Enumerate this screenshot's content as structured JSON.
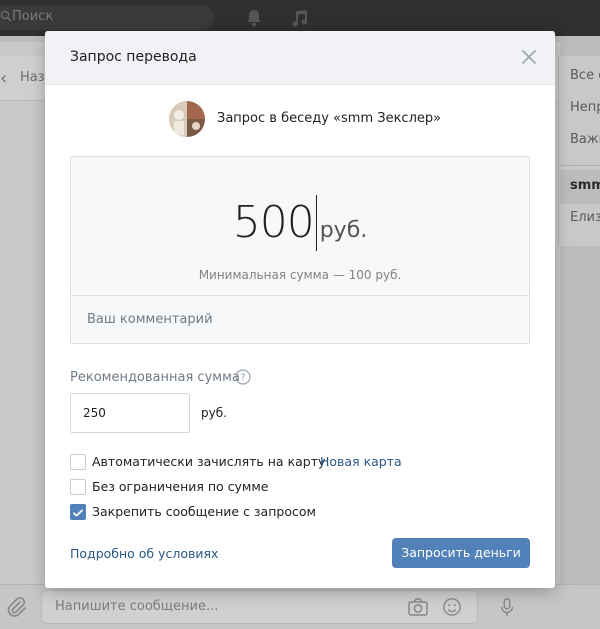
{
  "topbar": {
    "search_placeholder": "Поиск"
  },
  "background": {
    "back_label": "Наз",
    "right_panel_items": [
      "Все с",
      "Непр",
      "Важн",
      "smm",
      "Елиз"
    ],
    "compose_placeholder": "Напишите сообщение..."
  },
  "modal": {
    "title": "Запрос перевода",
    "conversation_text": "Запрос в беседу «smm Зекслер»",
    "amount": {
      "value": "500",
      "currency": "руб.",
      "min_note": "Минимальная сумма — 100 руб.",
      "comment_placeholder": "Ваш комментарий"
    },
    "recommended": {
      "label": "Рекомендованная сумма",
      "value": "250",
      "unit": "руб."
    },
    "options": [
      {
        "label": "Автоматически зачислять на карту:",
        "link": "Новая карта",
        "checked": false
      },
      {
        "label": "Без ограничения по сумме",
        "checked": false
      },
      {
        "label": "Закрепить сообщение с запросом",
        "checked": true
      }
    ],
    "terms_link": "Подробно об условиях",
    "submit_label": "Запросить деньги"
  },
  "colors": {
    "accent": "#5181b8",
    "link": "#2a5885",
    "header_bg": "#f0f2f5"
  }
}
